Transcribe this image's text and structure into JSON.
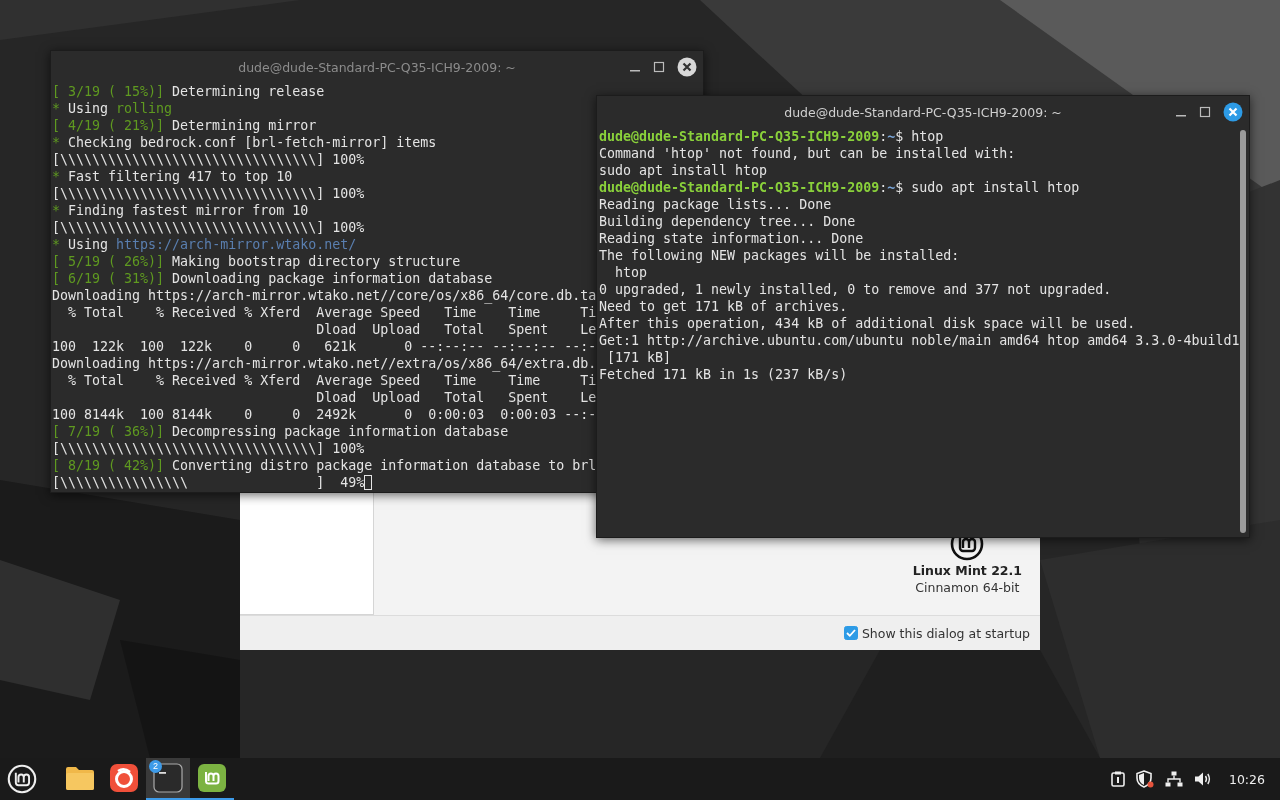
{
  "welcome_dialog": {
    "edition": "Linux Mint 22.1",
    "desktop": "Cinnamon 64-bit",
    "startup_checkbox": {
      "label": "Show this dialog at startup",
      "checked": true
    }
  },
  "terminals": [
    {
      "title": "dude@dude-Standard-PC-Q35-ICH9-2009: ~",
      "active": false,
      "cursor_visible": true,
      "lines": [
        {
          "parts": [
            {
              "kind": "tag",
              "text": "[ 3/19 ( 15%)]"
            },
            {
              "kind": "plain",
              "text": " Determining release"
            }
          ]
        },
        {
          "parts": [
            {
              "kind": "tag",
              "text": "*"
            },
            {
              "kind": "plain",
              "text": " Using "
            },
            {
              "kind": "tag",
              "text": "rolling"
            }
          ]
        },
        {
          "parts": [
            {
              "kind": "tag",
              "text": "[ 4/19 ( 21%)]"
            },
            {
              "kind": "plain",
              "text": " Determining mirror"
            }
          ]
        },
        {
          "parts": [
            {
              "kind": "tag",
              "text": "*"
            },
            {
              "kind": "plain",
              "text": " Checking bedrock.conf [brl-fetch-mirror] items"
            }
          ]
        },
        {
          "parts": [
            {
              "kind": "plain",
              "text": "[\\\\\\\\\\\\\\\\\\\\\\\\\\\\\\\\\\\\\\\\\\\\\\\\\\\\\\\\\\\\\\\\] 100%"
            }
          ]
        },
        {
          "parts": [
            {
              "kind": "tag",
              "text": "*"
            },
            {
              "kind": "plain",
              "text": " Fast filtering 417 to top 10"
            }
          ]
        },
        {
          "parts": [
            {
              "kind": "plain",
              "text": "[\\\\\\\\\\\\\\\\\\\\\\\\\\\\\\\\\\\\\\\\\\\\\\\\\\\\\\\\\\\\\\\\] 100%"
            }
          ]
        },
        {
          "parts": [
            {
              "kind": "tag",
              "text": "*"
            },
            {
              "kind": "plain",
              "text": " Finding fastest mirror from 10"
            }
          ]
        },
        {
          "parts": [
            {
              "kind": "plain",
              "text": "[\\\\\\\\\\\\\\\\\\\\\\\\\\\\\\\\\\\\\\\\\\\\\\\\\\\\\\\\\\\\\\\\] 100%"
            }
          ]
        },
        {
          "parts": [
            {
              "kind": "tag",
              "text": "*"
            },
            {
              "kind": "plain",
              "text": " Using "
            },
            {
              "kind": "link",
              "text": "https://arch-mirror.wtako.net/"
            }
          ]
        },
        {
          "parts": [
            {
              "kind": "tag",
              "text": "[ 5/19 ( 26%)]"
            },
            {
              "kind": "plain",
              "text": " Making bootstrap directory structure"
            }
          ]
        },
        {
          "parts": [
            {
              "kind": "tag",
              "text": "[ 6/19 ( 31%)]"
            },
            {
              "kind": "plain",
              "text": " Downloading package information database"
            }
          ]
        },
        {
          "parts": [
            {
              "kind": "plain",
              "text": "Downloading https://arch-mirror.wtako.net//core/os/x86_64/core.db.ta"
            }
          ]
        },
        {
          "parts": [
            {
              "kind": "plain",
              "text": "  % Total    % Received % Xferd  Average Speed   Time    Time     Ti"
            }
          ]
        },
        {
          "parts": [
            {
              "kind": "plain",
              "text": "                                 Dload  Upload   Total   Spent    Le"
            }
          ]
        },
        {
          "parts": [
            {
              "kind": "plain",
              "text": "100  122k  100  122k    0     0   621k      0 --:--:-- --:--:-- --:-"
            }
          ]
        },
        {
          "parts": [
            {
              "kind": "plain",
              "text": "Downloading https://arch-mirror.wtako.net//extra/os/x86_64/extra.db."
            }
          ]
        },
        {
          "parts": [
            {
              "kind": "plain",
              "text": "  % Total    % Received % Xferd  Average Speed   Time    Time     Ti"
            }
          ]
        },
        {
          "parts": [
            {
              "kind": "plain",
              "text": "                                 Dload  Upload   Total   Spent    Le"
            }
          ]
        },
        {
          "parts": [
            {
              "kind": "plain",
              "text": "100 8144k  100 8144k    0     0  2492k      0  0:00:03  0:00:03 --:-"
            }
          ]
        },
        {
          "parts": [
            {
              "kind": "tag",
              "text": "[ 7/19 ( 36%)]"
            },
            {
              "kind": "plain",
              "text": " Decompressing package information database"
            }
          ]
        },
        {
          "parts": [
            {
              "kind": "plain",
              "text": "[\\\\\\\\\\\\\\\\\\\\\\\\\\\\\\\\\\\\\\\\\\\\\\\\\\\\\\\\\\\\\\\\] 100%"
            }
          ]
        },
        {
          "parts": [
            {
              "kind": "tag",
              "text": "[ 8/19 ( 42%)]"
            },
            {
              "kind": "plain",
              "text": " Converting distro package information database to brl"
            }
          ]
        },
        {
          "parts": [
            {
              "kind": "plain",
              "text": "[\\\\\\\\\\\\\\\\\\\\\\\\\\\\\\\\                ]  49%"
            }
          ]
        }
      ]
    },
    {
      "title": "dude@dude-Standard-PC-Q35-ICH9-2009: ~",
      "active": true,
      "cursor_visible": false,
      "lines": [
        {
          "parts": [
            {
              "kind": "prompt",
              "text": "dude@dude-Standard-PC-Q35-ICH9-2009"
            },
            {
              "kind": "plain",
              "text": ":"
            },
            {
              "kind": "path",
              "text": "~"
            },
            {
              "kind": "plain",
              "text": "$ htop"
            }
          ]
        },
        {
          "parts": [
            {
              "kind": "plain",
              "text": "Command 'htop' not found, but can be installed with:"
            }
          ]
        },
        {
          "parts": [
            {
              "kind": "plain",
              "text": "sudo apt install htop"
            }
          ]
        },
        {
          "parts": [
            {
              "kind": "prompt",
              "text": "dude@dude-Standard-PC-Q35-ICH9-2009"
            },
            {
              "kind": "plain",
              "text": ":"
            },
            {
              "kind": "path",
              "text": "~"
            },
            {
              "kind": "plain",
              "text": "$ sudo apt install htop"
            }
          ]
        },
        {
          "parts": [
            {
              "kind": "plain",
              "text": "Reading package lists... Done"
            }
          ]
        },
        {
          "parts": [
            {
              "kind": "plain",
              "text": "Building dependency tree... Done"
            }
          ]
        },
        {
          "parts": [
            {
              "kind": "plain",
              "text": "Reading state information... Done"
            }
          ]
        },
        {
          "parts": [
            {
              "kind": "plain",
              "text": "The following NEW packages will be installed:"
            }
          ]
        },
        {
          "parts": [
            {
              "kind": "plain",
              "text": "  htop"
            }
          ]
        },
        {
          "parts": [
            {
              "kind": "plain",
              "text": "0 upgraded, 1 newly installed, 0 to remove and 377 not upgraded."
            }
          ]
        },
        {
          "parts": [
            {
              "kind": "plain",
              "text": "Need to get 171 kB of archives."
            }
          ]
        },
        {
          "parts": [
            {
              "kind": "plain",
              "text": "After this operation, 434 kB of additional disk space will be used."
            }
          ]
        },
        {
          "parts": [
            {
              "kind": "plain",
              "text": "Get:1 http://archive.ubuntu.com/ubuntu noble/main amd64 htop amd64 3.3.0-4build1"
            }
          ]
        },
        {
          "parts": [
            {
              "kind": "plain",
              "text": " [171 kB]"
            }
          ]
        },
        {
          "parts": [
            {
              "kind": "plain",
              "text": "Fetched 171 kB in 1s (237 kB/s)"
            }
          ]
        }
      ]
    }
  ],
  "taskbar": {
    "apps": [
      {
        "kind": "folder",
        "running": false,
        "selected": false
      },
      {
        "kind": "swirl",
        "running": false,
        "selected": false
      },
      {
        "kind": "terminal",
        "running": true,
        "selected": true,
        "badge": "2"
      },
      {
        "kind": "mint",
        "running": true,
        "selected": false
      }
    ],
    "tray": [
      {
        "kind": "clipboard"
      },
      {
        "kind": "shield"
      },
      {
        "kind": "network"
      },
      {
        "kind": "volume"
      }
    ],
    "clock": "10:26"
  }
}
